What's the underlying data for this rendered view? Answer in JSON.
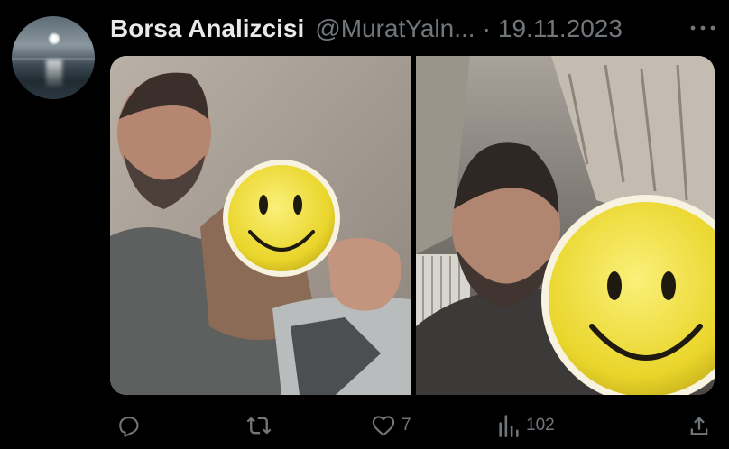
{
  "tweet": {
    "display_name": "Borsa Analizcisi",
    "handle": "@MuratYaln...",
    "separator": "·",
    "date": "19.11.2023"
  },
  "media": {
    "photos": [
      {
        "subject": "man-with-child-face-covered-by-smiley"
      },
      {
        "subject": "man-with-child-face-covered-by-smiley"
      }
    ]
  },
  "actions": {
    "reply": {
      "icon": "reply-icon",
      "count": ""
    },
    "retweet": {
      "icon": "retweet-icon",
      "count": ""
    },
    "like": {
      "icon": "heart-icon",
      "count": "7"
    },
    "views": {
      "icon": "views-icon",
      "count": "102"
    },
    "share": {
      "icon": "share-icon",
      "count": ""
    }
  },
  "colors": {
    "background": "#000000",
    "text_primary": "#e7e9ea",
    "text_secondary": "#71767b",
    "smiley_yellow": "#f2e23a"
  }
}
